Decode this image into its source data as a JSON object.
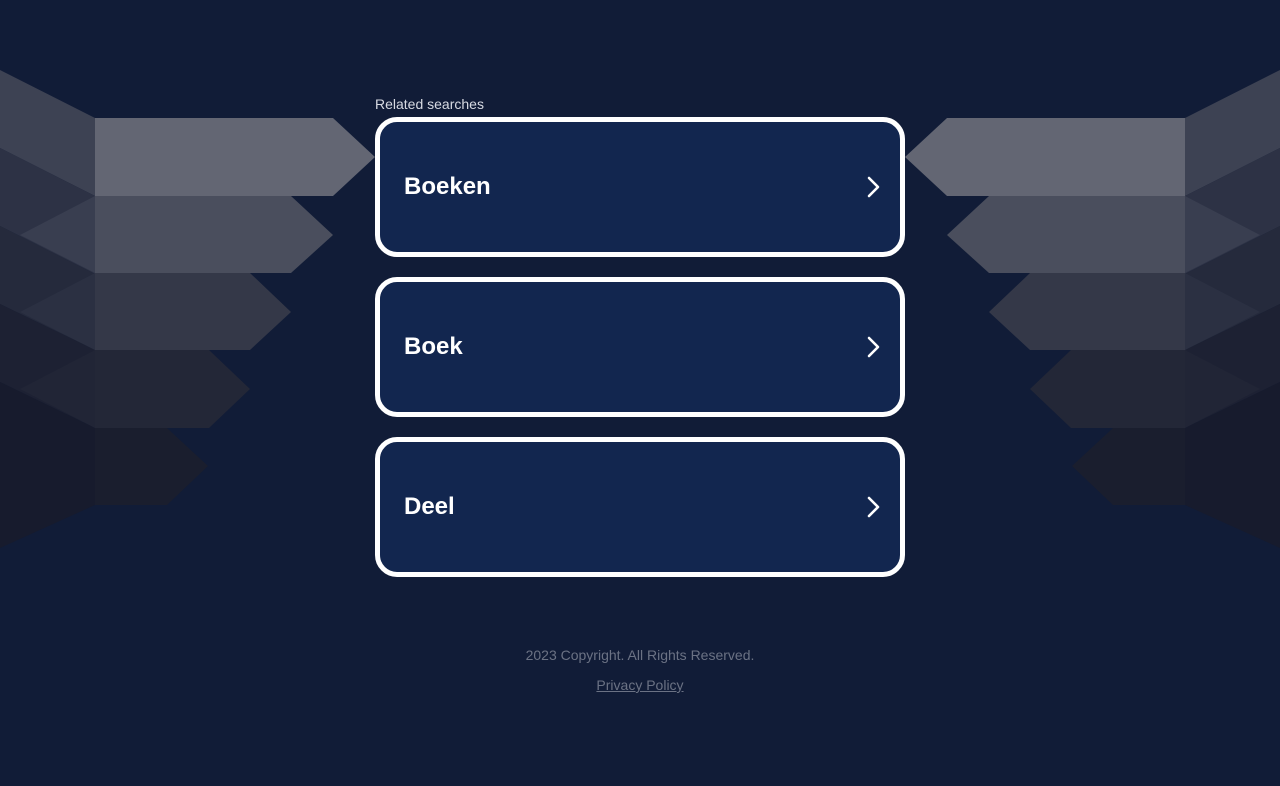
{
  "colors": {
    "background": "#111c37",
    "card_background": "#12264f",
    "card_border": "#ffffff",
    "card_text": "#ffffff",
    "footer_text": "#6b7284"
  },
  "related": {
    "title": "Related searches",
    "items": [
      {
        "label": "Boeken",
        "icon": "chevron-right-icon"
      },
      {
        "label": "Boek",
        "icon": "chevron-right-icon"
      },
      {
        "label": "Deel",
        "icon": "chevron-right-icon"
      }
    ]
  },
  "footer": {
    "copyright": "2023 Copyright. All Rights Reserved.",
    "privacy_label": "Privacy Policy"
  }
}
